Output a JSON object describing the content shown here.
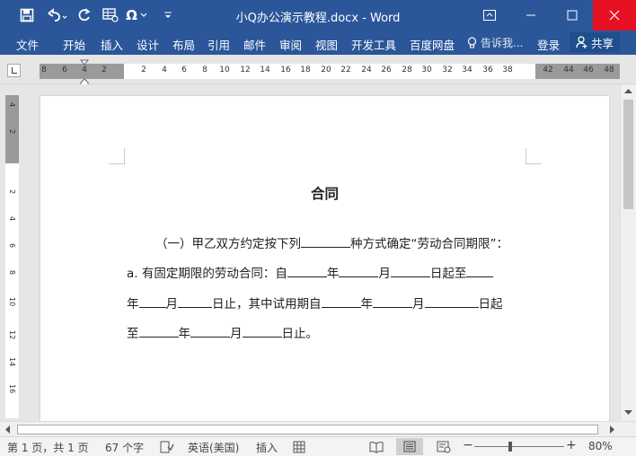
{
  "window": {
    "title": "小Q办公演示教程.docx - Word"
  },
  "quick_access": {
    "icons": [
      "save-icon",
      "undo-icon",
      "redo-icon",
      "insert-table-icon",
      "omega-symbol-icon",
      "customize-qat-icon"
    ]
  },
  "ribbon": {
    "tabs": [
      "文件",
      "开始",
      "插入",
      "设计",
      "布局",
      "引用",
      "邮件",
      "审阅",
      "视图",
      "开发工具",
      "百度网盘"
    ],
    "tell_me": "告诉我...",
    "signin": "登录",
    "share": "共享"
  },
  "ruler": {
    "horizontal_labels": [
      "8",
      "6",
      "4",
      "2",
      "2",
      "4",
      "6",
      "8",
      "10",
      "12",
      "14",
      "16",
      "18",
      "20",
      "22",
      "24",
      "26",
      "28",
      "30",
      "32",
      "34",
      "36",
      "38",
      "42",
      "44",
      "46",
      "48"
    ],
    "vertical_labels": [
      "4",
      "2",
      "2",
      "4",
      "6",
      "8",
      "10",
      "12",
      "14",
      "16"
    ]
  },
  "document": {
    "heading": "合同",
    "line1": {
      "before": "（一）甲乙双方约定按下列",
      "after": "种方式确定“劳动合同期限”："
    },
    "line2": {
      "prefix": "a. 有固定期限的劳动合同：自",
      "year": "年",
      "month": "月",
      "day_from": "日起至"
    },
    "line3": {
      "year": "年",
      "month": "月",
      "day_end": "日止，其中试用期自",
      "year2": "年",
      "month2": "月",
      "day_from": "日起"
    },
    "line4": {
      "prefix": "至",
      "year": "年",
      "month": "月",
      "day_end": "日止。"
    }
  },
  "status": {
    "page": "第 1 页，共 1 页",
    "words": "67 个字",
    "language": "英语(美国)",
    "mode": "插入",
    "zoom": "80%"
  },
  "colors": {
    "ribbon": "#2b579a",
    "close": "#e81123",
    "canvas": "#e6e6e6"
  }
}
